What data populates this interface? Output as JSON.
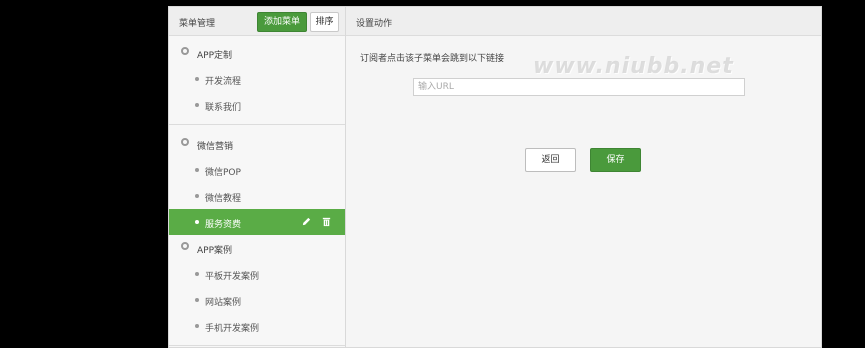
{
  "sidebar": {
    "title": "菜单管理",
    "add_label": "添加菜单",
    "sort_label": "排序",
    "groups": [
      {
        "label": "APP定制",
        "items": [
          "开发流程",
          "联系我们"
        ]
      },
      {
        "label": "微信营销",
        "items": [
          "微信POP",
          "微信教程",
          "服务资费"
        ]
      },
      {
        "label": "APP案例",
        "items": [
          "平板开发案例",
          "网站案例",
          "手机开发案例"
        ]
      }
    ],
    "active_item": "服务资费"
  },
  "main": {
    "title": "设置动作",
    "hint": "订阅者点击该子菜单会跳到以下链接",
    "url_placeholder": "输入URL",
    "back_label": "返回",
    "save_label": "保存"
  },
  "watermark": "www.niubb.net",
  "colors": {
    "accent": "#5aac46",
    "button_green": "#4a9a3c"
  },
  "icons": [
    "gear-icon",
    "edit-icon",
    "trash-icon"
  ]
}
